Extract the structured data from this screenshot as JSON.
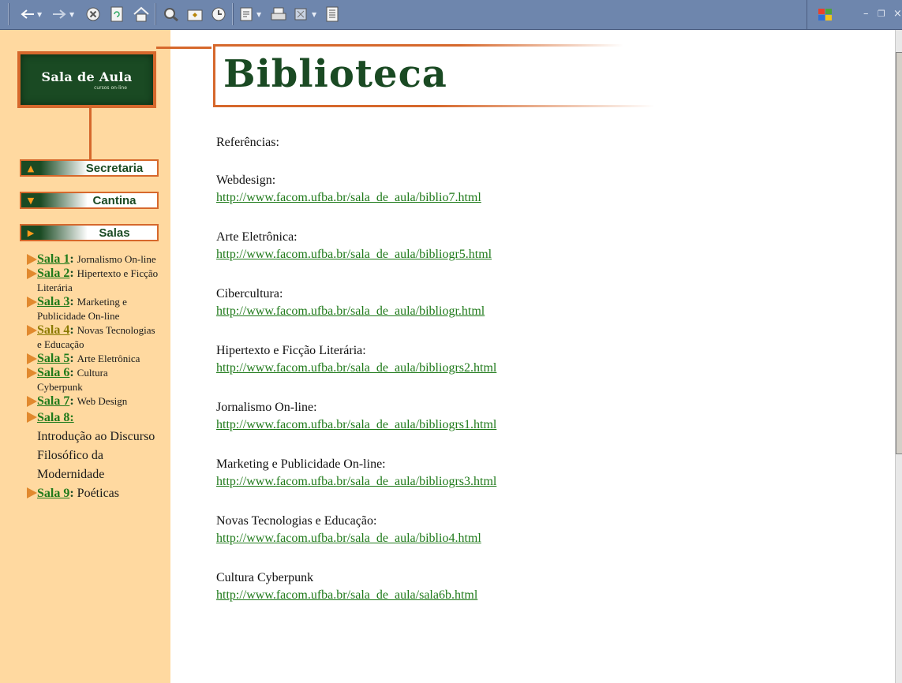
{
  "toolbar": {
    "winctl_minimize": "–",
    "winctl_restore": "❐",
    "winctl_close": "×"
  },
  "sidebar": {
    "logo_title": "Sala de Aula",
    "logo_subtitle": "cursos on-line",
    "nav": [
      {
        "label": "Secretaria",
        "glyph": "▲"
      },
      {
        "label": "Cantina",
        "glyph": "▼"
      },
      {
        "label": "Salas",
        "glyph": "▶"
      }
    ],
    "salas": [
      {
        "link": "Sala 1",
        "desc": "Jornalismo On-line"
      },
      {
        "link": "Sala 2",
        "desc": "Hipertexto e Ficção Literária"
      },
      {
        "link": "Sala 3",
        "desc": "Marketing e Publicidade On-line"
      },
      {
        "link": "Sala 4",
        "desc": "Novas Tecnologias e Educação"
      },
      {
        "link": "Sala 5",
        "desc": "Arte Eletrônica"
      },
      {
        "link": "Sala 6",
        "desc": "Cultura Cyberpunk"
      },
      {
        "link": "Sala 7",
        "desc": "Web Design"
      },
      {
        "link": "Sala 8:",
        "desc": "Introdução ao Discurso Filosófico da Modernidade"
      },
      {
        "link": "Sala 9",
        "desc": "Poéticas"
      }
    ]
  },
  "main": {
    "title": "Biblioteca",
    "intro": "Referências:",
    "references": [
      {
        "title": "Webdesign:",
        "url": "http://www.facom.ufba.br/sala_de_aula/biblio7.html"
      },
      {
        "title": "Arte Eletrônica:",
        "url": "http://www.facom.ufba.br/sala_de_aula/bibliogr5.html"
      },
      {
        "title": "Cibercultura:",
        "url": "http://www.facom.ufba.br/sala_de_aula/bibliogr.html"
      },
      {
        "title": "Hipertexto e Ficção Literária:",
        "url": "http://www.facom.ufba.br/sala_de_aula/bibliogrs2.html"
      },
      {
        "title": "Jornalismo On-line:",
        "url": "http://www.facom.ufba.br/sala_de_aula/bibliogrs1.html"
      },
      {
        "title": "Marketing e Publicidade On-line:",
        "url": "http://www.facom.ufba.br/sala_de_aula/bibliogrs3.html"
      },
      {
        "title": "Novas Tecnologias e Educação:",
        "url": "http://www.facom.ufba.br/sala_de_aula/biblio4.html"
      },
      {
        "title": "Cultura Cyberpunk",
        "url": "http://www.facom.ufba.br/sala_de_aula/sala6b.html"
      }
    ]
  },
  "colors": {
    "toolbar": "#6e86ad",
    "sidebar": "#ffd9a0",
    "accent_orange": "#d6682c",
    "dark_green": "#1a4a23",
    "link_green": "#1f7a1a"
  }
}
